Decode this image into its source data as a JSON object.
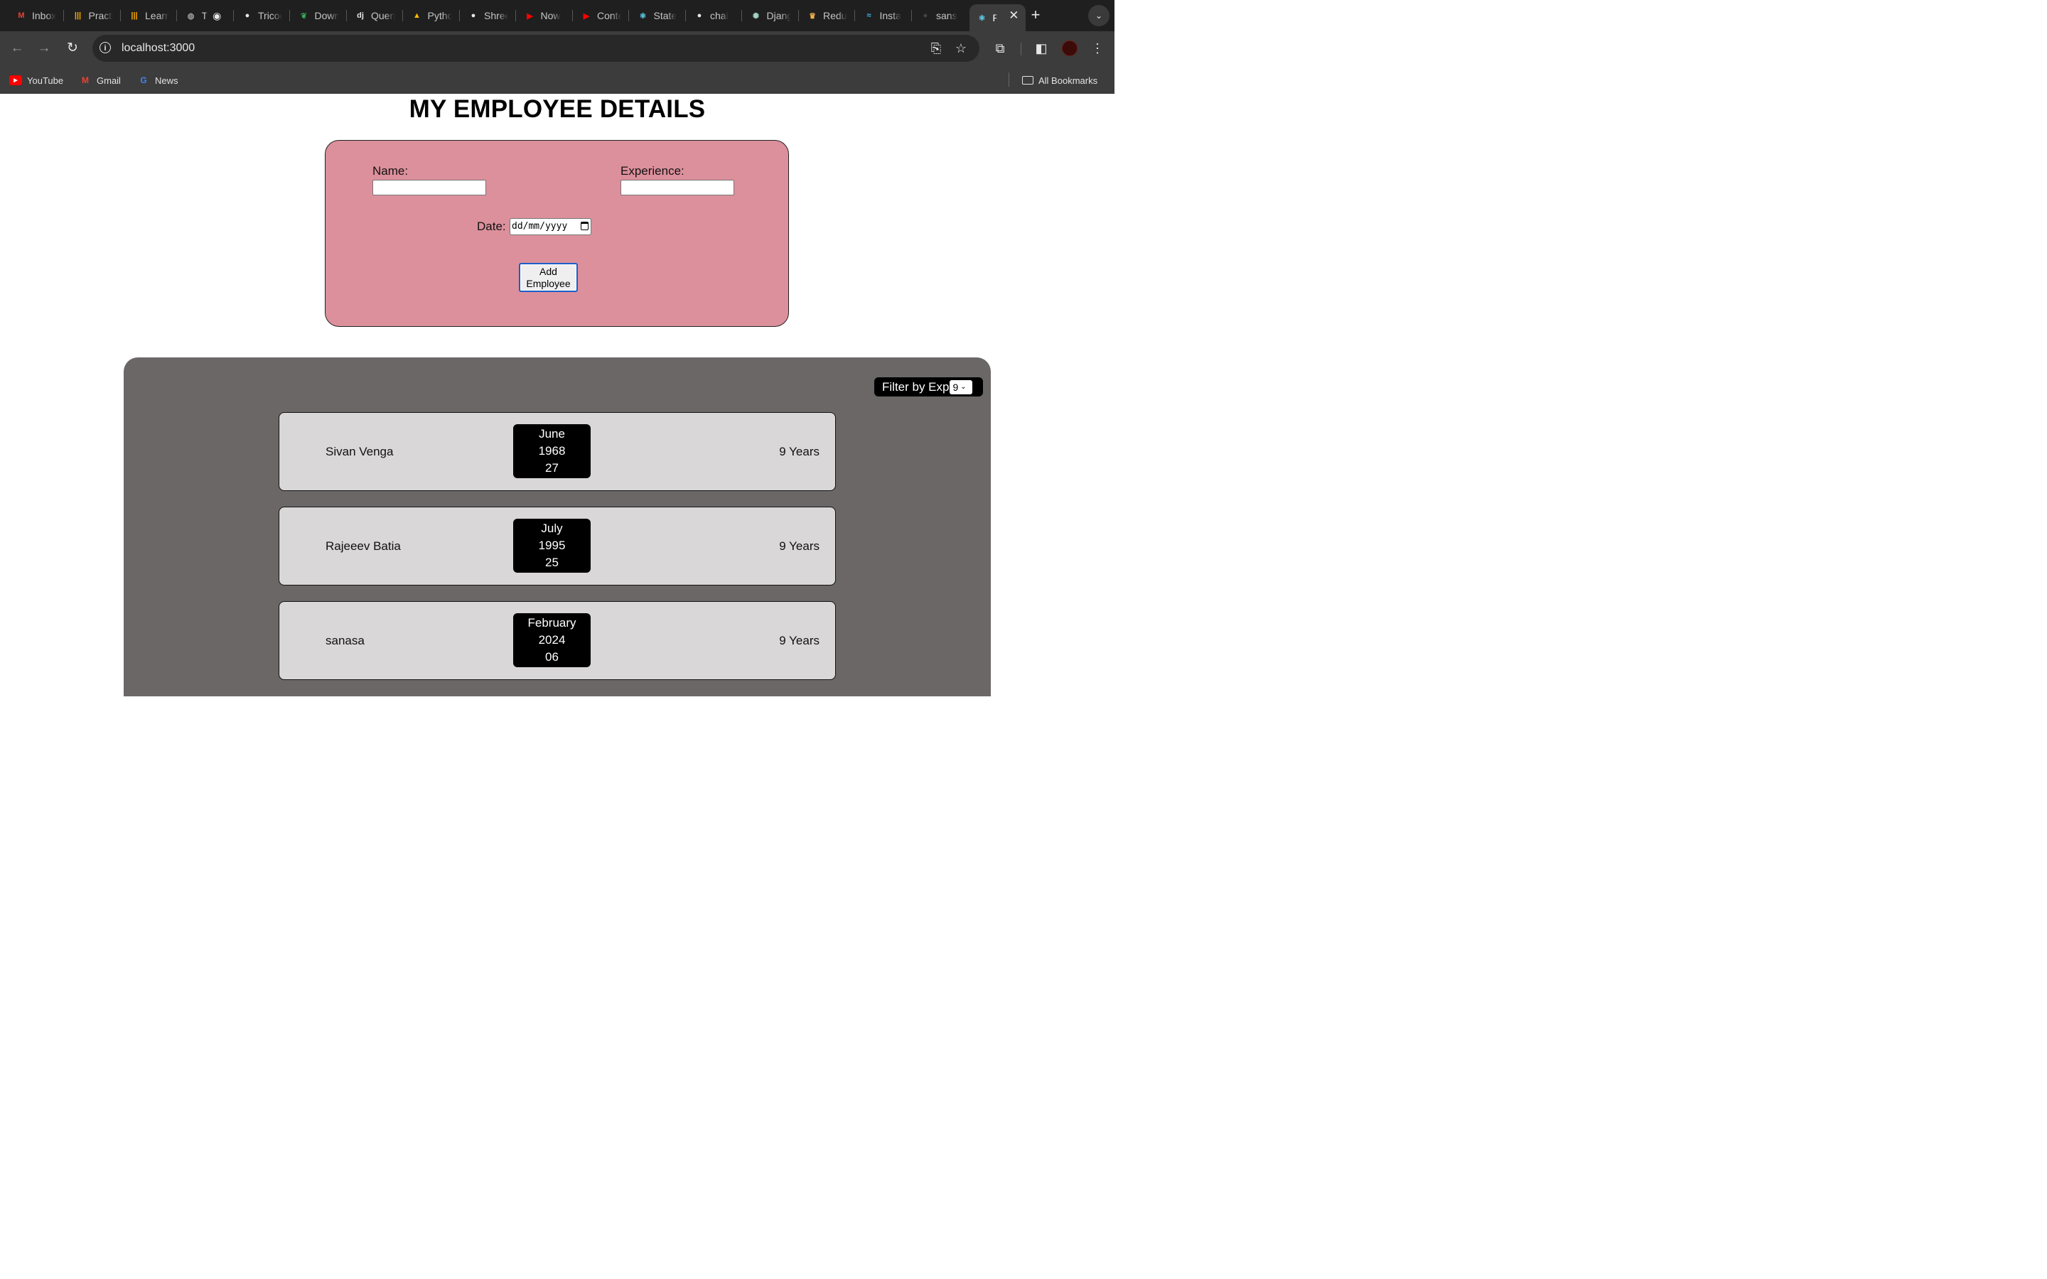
{
  "browser": {
    "tabs": [
      {
        "label": "Inbox",
        "icon": "gmail-icon",
        "glyph": "M",
        "color": "#ea4335"
      },
      {
        "label": "Practice",
        "icon": "chart-bars-icon",
        "glyph": "|||",
        "color": "#f9ab00"
      },
      {
        "label": "Learn",
        "icon": "chart-bars-icon",
        "glyph": "|||",
        "color": "#f9ab00"
      },
      {
        "label": "T",
        "icon": "globe-icon",
        "glyph": "◍",
        "color": "#9aa0a6"
      },
      {
        "label": "Tricode",
        "icon": "github-icon",
        "glyph": "●",
        "color": "#e8e8e8"
      },
      {
        "label": "Download",
        "icon": "leaf-icon",
        "glyph": "❦",
        "color": "#34a853"
      },
      {
        "label": "Queries",
        "icon": "django-icon",
        "glyph": "dj",
        "color": "#e8e8e8"
      },
      {
        "label": "Python",
        "icon": "drive-icon",
        "glyph": "▲",
        "color": "#fbbc04"
      },
      {
        "label": "Shree",
        "icon": "github-icon",
        "glyph": "●",
        "color": "#e8e8e8"
      },
      {
        "label": "Now",
        "icon": "youtube-icon",
        "glyph": "▶",
        "color": "#ff0000"
      },
      {
        "label": "Content",
        "icon": "youtube-icon",
        "glyph": "▶",
        "color": "#ff0000"
      },
      {
        "label": "State",
        "icon": "react-icon",
        "glyph": "⚛",
        "color": "#61dafb"
      },
      {
        "label": "chai",
        "icon": "github-icon",
        "glyph": "●",
        "color": "#e8e8e8"
      },
      {
        "label": "Django",
        "icon": "chatgpt-icon",
        "glyph": "✺",
        "color": "#9fd3c7"
      },
      {
        "label": "Redux",
        "icon": "redux-icon",
        "glyph": "♛",
        "color": "#f0b04b"
      },
      {
        "label": "Insta",
        "icon": "tailwind-icon",
        "glyph": "≈",
        "color": "#38bdf8"
      },
      {
        "label": "sans",
        "icon": "github-icon",
        "glyph": "●",
        "color": "#444444"
      },
      {
        "label": "React App",
        "icon": "react-icon",
        "glyph": "⚛",
        "color": "#61dafb",
        "active": true
      }
    ],
    "recording_indicator": "◉",
    "new_tab_glyph": "+",
    "tab_search_glyph": "⌄",
    "close_glyph": "✕",
    "url": "localhost:3000",
    "bookmarks": [
      {
        "label": "YouTube",
        "icon": "youtube-icon",
        "glyph": "▶",
        "color": "#ff0000"
      },
      {
        "label": "Gmail",
        "icon": "gmail-icon",
        "glyph": "M",
        "color": "#ea4335"
      },
      {
        "label": "News",
        "icon": "news-icon",
        "glyph": "G",
        "color": "#4285f4"
      }
    ],
    "all_bookmarks_label": "All Bookmarks"
  },
  "page": {
    "title": "MY EMPLOYEE DETAILS",
    "form": {
      "name_label": "Name:",
      "name_value": "",
      "experience_label": "Experience:",
      "experience_value": "",
      "date_label": "Date:",
      "date_placeholder": "dd/mm/yyyy",
      "add_button_label": "Add Employee"
    },
    "filter": {
      "label": "Filter by Exp",
      "selected": "9"
    },
    "employees": [
      {
        "name": "Sivan Venga",
        "month": "June",
        "year": "1968",
        "day": "27",
        "experience": "9 Years"
      },
      {
        "name": "Rajeeev Batia",
        "month": "July",
        "year": "1995",
        "day": "25",
        "experience": "9 Years"
      },
      {
        "name": "sanasa",
        "month": "February",
        "year": "2024",
        "day": "06",
        "experience": "9 Years"
      }
    ]
  }
}
